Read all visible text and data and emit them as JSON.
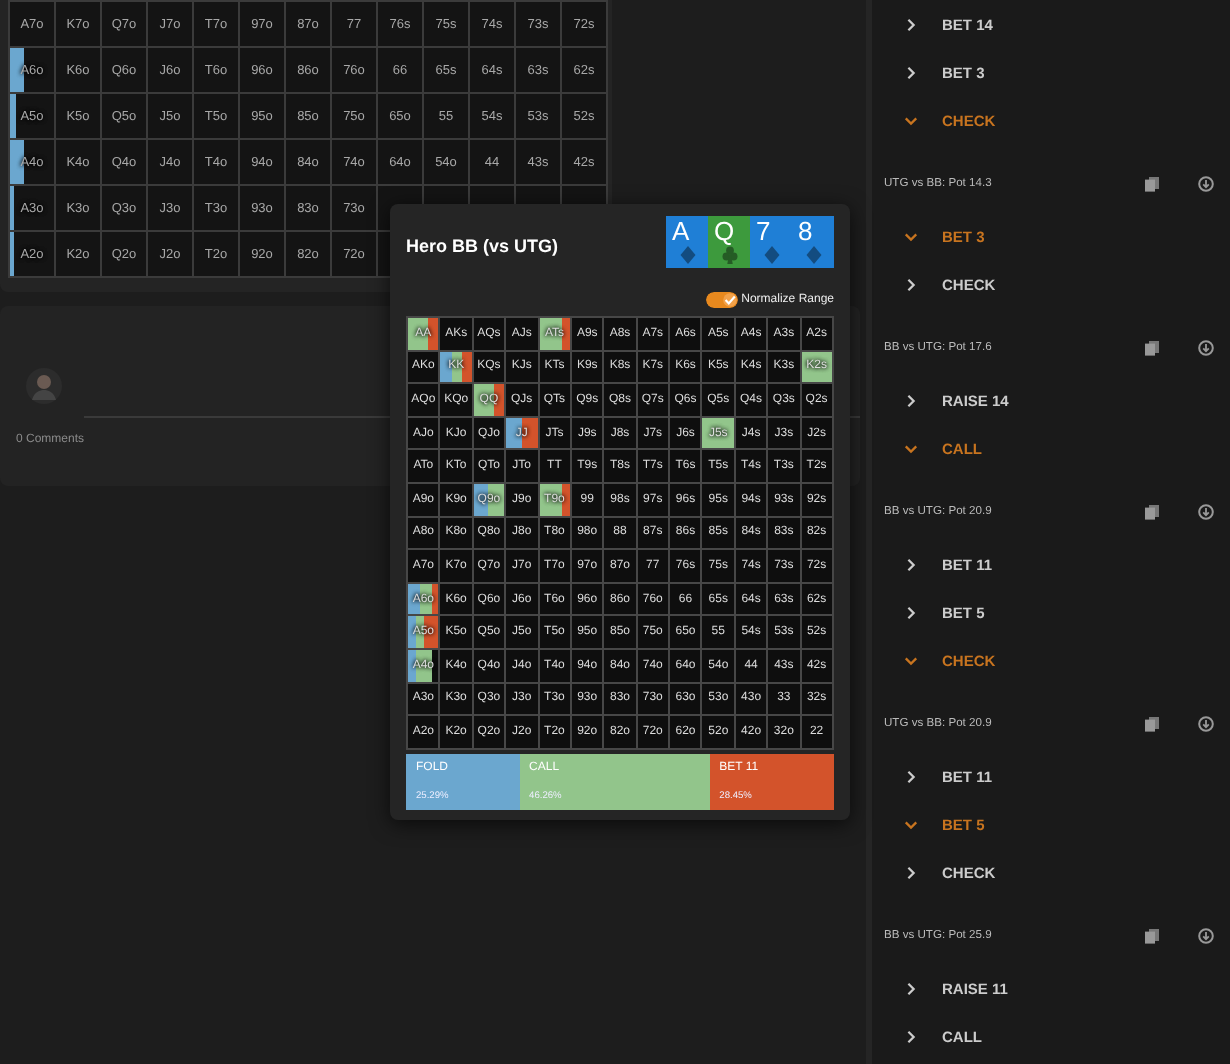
{
  "range_grid": {
    "rows": [
      [
        "A7o",
        "K7o",
        "Q7o",
        "J7o",
        "T7o",
        "97o",
        "87o",
        "77",
        "76s",
        "75s",
        "74s",
        "73s",
        "72s"
      ],
      [
        {
          "label": "A6o",
          "fill": {
            "kind": "fold",
            "level": 0.3
          }
        },
        "K6o",
        "Q6o",
        "J6o",
        "T6o",
        "96o",
        "86o",
        "76o",
        "66",
        "65s",
        "64s",
        "63s",
        "62s"
      ],
      [
        {
          "label": "A5o",
          "fill": {
            "kind": "fold",
            "level": 0.12
          }
        },
        "K5o",
        "Q5o",
        "J5o",
        "T5o",
        "95o",
        "85o",
        "75o",
        "65o",
        "55",
        "54s",
        "53s",
        "52s"
      ],
      [
        {
          "label": "A4o",
          "fill": {
            "kind": "fold",
            "level": 0.3
          }
        },
        "K4o",
        "Q4o",
        "J4o",
        "T4o",
        "94o",
        "84o",
        "74o",
        "64o",
        "54o",
        "44",
        "43s",
        "42s"
      ],
      [
        {
          "label": "A3o",
          "fill": {
            "kind": "fold",
            "level": 0.1
          }
        },
        "K3o",
        "Q3o",
        "J3o",
        "T3o",
        "93o",
        "83o",
        "73o"
      ],
      [
        {
          "label": "A2o",
          "fill": {
            "kind": "fold",
            "level": 0.1
          }
        },
        "K2o",
        "Q2o",
        "J2o",
        "T2o",
        "92o",
        "82o",
        "72o"
      ]
    ]
  },
  "comments": {
    "count_text": "0 Comments"
  },
  "popup": {
    "title": "Hero BB (vs UTG)",
    "board": [
      {
        "rank": "A",
        "kind": "diamond",
        "color": "#1f7fd6"
      },
      {
        "rank": "Q",
        "kind": "club",
        "color": "#3d9a3d"
      },
      {
        "rank": "7",
        "kind": "diamond",
        "color": "#1f7fd6"
      },
      {
        "rank": "8",
        "kind": "diamond",
        "color": "#1f7fd6"
      }
    ],
    "normalize": {
      "label": "Normalize Range",
      "on": true
    },
    "rows": [
      [
        {
          "label": "AA",
          "segments": [
            {
              "kind": "call"
            },
            {
              "kind": "call"
            },
            {
              "kind": "bet"
            }
          ]
        },
        "AKs",
        "AQs",
        "AJs",
        {
          "label": "ATs",
          "segments": [
            {
              "kind": "call"
            },
            {
              "kind": "call"
            },
            {
              "kind": "call"
            },
            {
              "kind": "bet"
            }
          ]
        },
        "A9s",
        "A8s",
        "A7s",
        "A6s",
        "A5s",
        "A4s",
        "A3s",
        "A2s"
      ],
      [
        "AKo",
        {
          "label": "KK",
          "segments": [
            {
              "kind": "fold"
            },
            {
              "kind": "call"
            },
            {
              "kind": "bet"
            }
          ]
        },
        "KQs",
        "KJs",
        "KTs",
        "K9s",
        "K8s",
        "K7s",
        "K6s",
        "K5s",
        "K4s",
        "K3s",
        {
          "label": "K2s",
          "segments": [
            {
              "kind": "call"
            }
          ]
        }
      ],
      [
        "AQo",
        "KQo",
        {
          "label": "QQ",
          "segments": [
            {
              "kind": "call"
            },
            {
              "kind": "call"
            },
            {
              "kind": "bet"
            }
          ]
        },
        "QJs",
        "QTs",
        "Q9s",
        "Q8s",
        "Q7s",
        "Q6s",
        "Q5s",
        "Q4s",
        "Q3s",
        "Q2s"
      ],
      [
        "AJo",
        "KJo",
        "QJo",
        {
          "label": "JJ",
          "segments": [
            {
              "kind": "fold"
            },
            {
              "kind": "bet"
            }
          ]
        },
        "JTs",
        "J9s",
        "J8s",
        "J7s",
        "J6s",
        {
          "label": "J5s",
          "segments": [
            {
              "kind": "call"
            }
          ]
        },
        "J4s",
        "J3s",
        "J2s"
      ],
      [
        "ATo",
        "KTo",
        "QTo",
        "JTo",
        "TT",
        "T9s",
        "T8s",
        "T7s",
        "T6s",
        "T5s",
        "T4s",
        "T3s",
        "T2s"
      ],
      [
        "A9o",
        "K9o",
        {
          "label": "Q9o",
          "segments": [
            {
              "kind": "fold"
            },
            {
              "kind": "call"
            }
          ]
        },
        "J9o",
        {
          "label": "T9o",
          "segments": [
            {
              "kind": "call"
            },
            {
              "kind": "call"
            },
            {
              "kind": "call"
            },
            {
              "kind": "bet"
            }
          ]
        },
        "99",
        "98s",
        "97s",
        "96s",
        "95s",
        "94s",
        "93s",
        "92s"
      ],
      [
        "A8o",
        "K8o",
        "Q8o",
        "J8o",
        "T8o",
        "98o",
        "88",
        "87s",
        "86s",
        "85s",
        "84s",
        "83s",
        "82s"
      ],
      [
        "A7o",
        "K7o",
        "Q7o",
        "J7o",
        "T7o",
        "97o",
        "87o",
        "77",
        "76s",
        "75s",
        "74s",
        "73s",
        "72s"
      ],
      [
        {
          "label": "A6o",
          "segments": [
            {
              "kind": "fold"
            },
            {
              "kind": "fold"
            },
            {
              "kind": "call"
            },
            {
              "kind": "call"
            },
            {
              "kind": "bet"
            }
          ]
        },
        "K6o",
        "Q6o",
        "J6o",
        "T6o",
        "96o",
        "86o",
        "76o",
        "66",
        "65s",
        "64s",
        "63s",
        "62s"
      ],
      [
        {
          "label": "A5o",
          "segments": [
            {
              "kind": "fold"
            },
            {
              "kind": "call"
            },
            {
              "kind": "bet"
            },
            {
              "kind": "bet"
            }
          ]
        },
        "K5o",
        "Q5o",
        "J5o",
        "T5o",
        "95o",
        "85o",
        "75o",
        "65o",
        "55",
        "54s",
        "53s",
        "52s"
      ],
      [
        {
          "label": "A4o",
          "segments": [
            {
              "kind": "fold"
            },
            {
              "kind": "call"
            },
            {
              "kind": "call"
            },
            {
              "kind": "none"
            }
          ]
        },
        "K4o",
        "Q4o",
        "J4o",
        "T4o",
        "94o",
        "84o",
        "74o",
        "64o",
        "54o",
        "44",
        "43s",
        "42s"
      ],
      [
        "A3o",
        "K3o",
        "Q3o",
        "J3o",
        "T3o",
        "93o",
        "83o",
        "73o",
        "63o",
        "53o",
        "43o",
        "33",
        "32s"
      ],
      [
        "A2o",
        "K2o",
        "Q2o",
        "J2o",
        "T2o",
        "92o",
        "82o",
        "72o",
        "62o",
        "52o",
        "42o",
        "32o",
        "22"
      ]
    ],
    "actions": [
      {
        "kind": "fold",
        "label": "FOLD",
        "share": "25.29%"
      },
      {
        "kind": "call",
        "label": "CALL",
        "share": "46.26%"
      },
      {
        "kind": "bet",
        "label": "BET 11",
        "share": "28.45%"
      }
    ]
  },
  "tree": [
    {
      "kind": "action",
      "label": "BET 14",
      "expanded": false
    },
    {
      "kind": "action",
      "label": "BET 3",
      "expanded": false
    },
    {
      "kind": "action",
      "label": "CHECK",
      "expanded": true
    },
    {
      "kind": "node",
      "label": "UTG vs BB: Pot 14.3"
    },
    {
      "kind": "action",
      "label": "BET 3",
      "expanded": true
    },
    {
      "kind": "action",
      "label": "CHECK",
      "expanded": false
    },
    {
      "kind": "node",
      "label": "BB vs UTG: Pot 17.6"
    },
    {
      "kind": "action",
      "label": "RAISE 14",
      "expanded": false
    },
    {
      "kind": "action",
      "label": "CALL",
      "expanded": true
    },
    {
      "kind": "node",
      "label": "BB vs UTG: Pot 20.9"
    },
    {
      "kind": "action",
      "label": "BET 11",
      "expanded": false
    },
    {
      "kind": "action",
      "label": "BET 5",
      "expanded": false
    },
    {
      "kind": "action",
      "label": "CHECK",
      "expanded": true
    },
    {
      "kind": "node",
      "label": "UTG vs BB: Pot 20.9"
    },
    {
      "kind": "action",
      "label": "BET 11",
      "expanded": false
    },
    {
      "kind": "action",
      "label": "BET 5",
      "expanded": true
    },
    {
      "kind": "action",
      "label": "CHECK",
      "expanded": false
    },
    {
      "kind": "node",
      "label": "BB vs UTG: Pot 25.9"
    },
    {
      "kind": "action",
      "label": "RAISE 11",
      "expanded": false
    },
    {
      "kind": "action",
      "label": "CALL",
      "expanded": false
    }
  ]
}
